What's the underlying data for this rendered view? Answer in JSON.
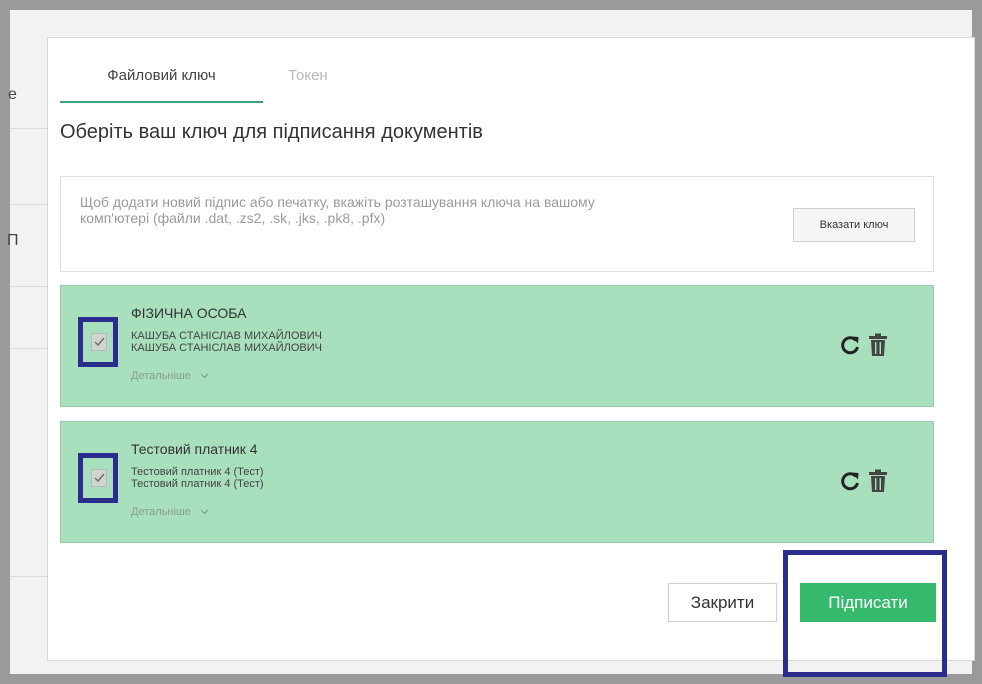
{
  "backdrop": {
    "left_fragments": [
      "e",
      "П"
    ]
  },
  "dialog": {
    "tabs": [
      {
        "label": "Файловий ключ",
        "active": true
      },
      {
        "label": "Токен",
        "active": false
      }
    ],
    "title": "Оберіть ваш ключ для підписання документів",
    "info": {
      "text": "Щоб додати новий підпис або печатку, вкажіть розташування ключа на вашому комп'ютері (файли .dat, .zs2, .sk, .jks, .pk8, .pfx)",
      "button_label": "Вказати ключ"
    },
    "keys": [
      {
        "title": "ФІЗИЧНА ОСОБА",
        "line1": "КАШУБА СТАНІСЛАВ МИХАЙЛОВИЧ",
        "line2": "КАШУБА СТАНІСЛАВ МИХАЙЛОВИЧ",
        "details_label": "Детальніше",
        "checked": true
      },
      {
        "title": "Тестовий платник 4",
        "line1": "Тестовий платник 4 (Тест)",
        "line2": "Тестовий платник 4 (Тест)",
        "details_label": "Детальніше",
        "checked": true
      }
    ],
    "buttons": {
      "close_label": "Закрити",
      "sign_label": "Підписати"
    }
  },
  "colors": {
    "accent": "#3d9f8a",
    "card_bg": "#a8dfbd",
    "sign_button": "#34b96d",
    "highlight": "#2b2d8c"
  },
  "icons": [
    "check-icon",
    "chevron-down-icon",
    "refresh-icon",
    "trash-icon"
  ]
}
